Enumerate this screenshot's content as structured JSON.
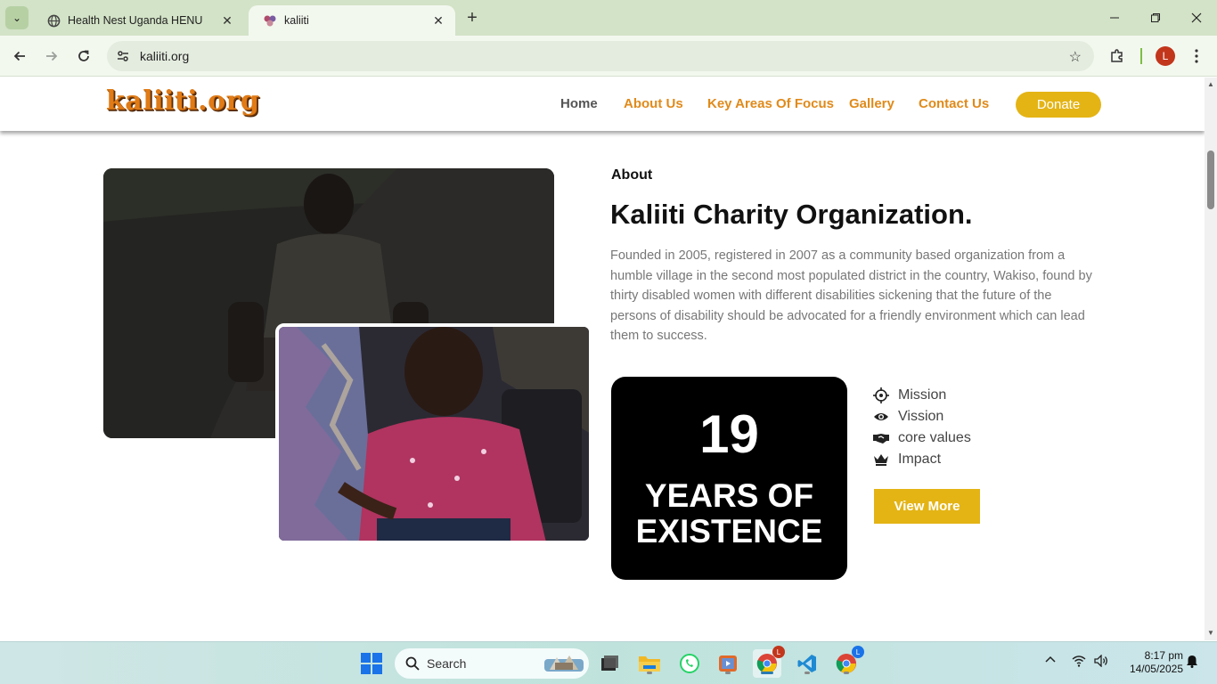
{
  "browser": {
    "tabs": [
      {
        "title": "Health Nest Uganda HENU",
        "active": false
      },
      {
        "title": "kaliiti",
        "active": true
      }
    ],
    "url": "kaliiti.org",
    "profile_initial": "L"
  },
  "site": {
    "logo": "kaliiti.org",
    "nav": [
      "Home",
      "About Us",
      "Key Areas Of Focus",
      "Gallery",
      "Contact Us"
    ],
    "donate_label": "Donate"
  },
  "about": {
    "label": "About",
    "title": "Kaliiti Charity Organization.",
    "text": "Founded in 2005, registered in 2007 as a community based organization from a humble village in the second most populated district in the country, Wakiso, found by thirty disabled women with different disabilities sickening that the future of the persons of disability should be advocated for a friendly environment which can lead them to success.",
    "years_number": "19",
    "years_label": "YEARS OF EXISTENCE",
    "features": [
      {
        "icon": "crosshair-icon",
        "label": "Mission"
      },
      {
        "icon": "eye-icon",
        "label": "Vission"
      },
      {
        "icon": "handshake-icon",
        "label": "core values"
      },
      {
        "icon": "crown-icon",
        "label": "Impact"
      }
    ],
    "view_more_label": "View More"
  },
  "taskbar": {
    "search_label": "Search",
    "time": "8:17 pm",
    "date": "14/05/2025"
  },
  "colors": {
    "accent_orange": "#e08a1a",
    "button_gold": "#e4b415",
    "chrome_green": "#d3e3c7"
  }
}
